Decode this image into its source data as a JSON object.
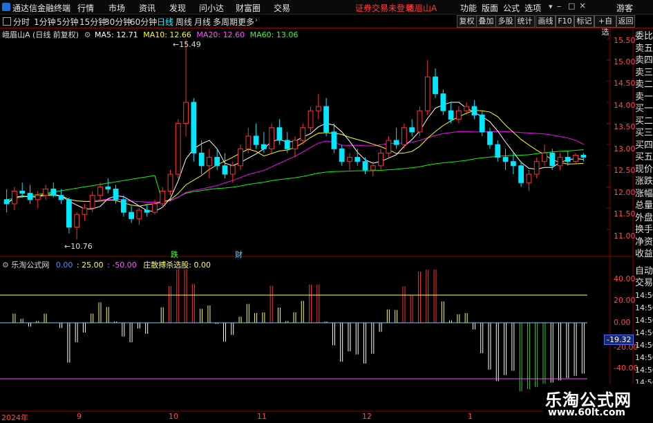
{
  "menu": {
    "app_title": "通达信金融终端",
    "items": [
      "行情",
      "市场",
      "资讯",
      "发现",
      "问小达",
      "财富圈",
      "交易"
    ],
    "status": "证券交易未登录",
    "stock": "峨眉山A",
    "right": [
      "功能",
      "版面",
      "公式",
      "选项"
    ],
    "guest": "游客"
  },
  "toolbar": {
    "periods": [
      "分时",
      "1分钟",
      "5分钟",
      "15分钟",
      "30分钟",
      "60分钟",
      "日线",
      "周线",
      "月线",
      "多周期",
      "更多"
    ],
    "active_period": "日线",
    "right_buttons": [
      "复权",
      "叠加",
      "多股",
      "统计",
      "画线",
      "F10",
      "标记",
      "+自选",
      "返回"
    ]
  },
  "legend": {
    "title": "峨眉山A (日线 前复权)",
    "ma5": "MA5: 12.71",
    "ma10": "MA10: 12.66",
    "ma20": "MA20: 12.60",
    "ma60": "MA60: 13.06",
    "colors": {
      "ma5": "#ffffff",
      "ma10": "#ffff00",
      "ma20": "#ff00ff",
      "ma60": "#00ff00"
    }
  },
  "indicator": {
    "name": "乐淘公式网",
    "v1": "0.00",
    "v2": ": 25.00",
    "v3": ": -50.00",
    "formula": "庄散搏杀选股: 0.00",
    "current": "-19.32"
  },
  "price_axis": [
    "15.50",
    "15.00",
    "14.50",
    "14.00",
    "13.50",
    "13.00",
    "12.50",
    "12.00",
    "11.50",
    "11.00"
  ],
  "ind_axis": [
    "40.00",
    "20.00",
    "0.00",
    "-20.00",
    "-40.00"
  ],
  "annotations": {
    "high": "15.49",
    "low": "10.76",
    "mark1": "跌",
    "mark2": "财"
  },
  "x_labels": [
    "2024年",
    "9",
    "10",
    "11",
    "12",
    "1"
  ],
  "side_panel": [
    "委比",
    "卖五",
    "卖四",
    "卖三",
    "卖二",
    "卖一",
    "买一",
    "买二",
    "买三",
    "买四",
    "买五",
    "现价",
    "涨跌",
    "涨幅",
    "总量",
    "外盘",
    "换手",
    "净资",
    "收益"
  ],
  "side_panel2": [
    "自动",
    "交易"
  ],
  "ind_side": [
    "14:56",
    "14:56",
    "14:56",
    "14:56",
    "14:56",
    "14:56",
    "14:56",
    "14:56",
    "14:56",
    "14:56"
  ],
  "watermark": {
    "line1": "乐淘公式网",
    "line2": "www.60lt.com"
  },
  "chart_data": {
    "type": "candlestick",
    "ylim": [
      10.7,
      15.6
    ],
    "ohlc": [
      [
        11.7,
        11.95,
        11.4,
        11.6
      ],
      [
        11.6,
        12.0,
        11.45,
        11.9
      ],
      [
        11.9,
        12.1,
        11.75,
        11.85
      ],
      [
        11.85,
        12.05,
        11.6,
        11.7
      ],
      [
        11.7,
        11.9,
        11.5,
        11.8
      ],
      [
        11.8,
        12.05,
        11.7,
        11.95
      ],
      [
        11.95,
        12.1,
        11.75,
        11.8
      ],
      [
        11.8,
        11.95,
        11.6,
        11.7
      ],
      [
        11.7,
        11.75,
        10.9,
        11.05
      ],
      [
        11.05,
        11.4,
        10.76,
        11.35
      ],
      [
        11.35,
        11.6,
        11.2,
        11.5
      ],
      [
        11.5,
        11.9,
        11.4,
        11.8
      ],
      [
        11.8,
        12.1,
        11.7,
        12.0
      ],
      [
        12.0,
        12.2,
        11.85,
        11.95
      ],
      [
        11.95,
        12.05,
        11.6,
        11.7
      ],
      [
        11.7,
        11.8,
        11.3,
        11.4
      ],
      [
        11.4,
        11.55,
        11.15,
        11.25
      ],
      [
        11.25,
        11.5,
        11.1,
        11.45
      ],
      [
        11.45,
        11.6,
        11.3,
        11.4
      ],
      [
        11.4,
        11.7,
        11.35,
        11.6
      ],
      [
        11.6,
        12.0,
        11.5,
        11.9
      ],
      [
        11.9,
        12.4,
        11.8,
        12.3
      ],
      [
        12.3,
        13.6,
        12.2,
        13.5
      ],
      [
        13.5,
        15.49,
        13.2,
        14.0
      ],
      [
        14.0,
        14.1,
        12.6,
        12.8
      ],
      [
        12.8,
        13.1,
        12.3,
        12.5
      ],
      [
        12.5,
        12.9,
        12.2,
        12.7
      ],
      [
        12.7,
        12.9,
        12.4,
        12.5
      ],
      [
        12.5,
        12.8,
        12.2,
        12.3
      ],
      [
        12.3,
        12.6,
        12.1,
        12.5
      ],
      [
        12.5,
        13.0,
        12.4,
        12.9
      ],
      [
        12.9,
        13.4,
        12.8,
        13.2
      ],
      [
        13.2,
        13.5,
        12.9,
        13.0
      ],
      [
        13.0,
        13.3,
        12.8,
        12.9
      ],
      [
        12.9,
        13.5,
        12.8,
        13.4
      ],
      [
        13.4,
        13.6,
        13.0,
        13.1
      ],
      [
        13.1,
        13.3,
        12.8,
        12.9
      ],
      [
        12.9,
        13.2,
        12.7,
        13.1
      ],
      [
        13.1,
        13.5,
        13.0,
        13.4
      ],
      [
        13.4,
        13.9,
        13.3,
        13.8
      ],
      [
        13.8,
        14.2,
        13.6,
        13.9
      ],
      [
        13.9,
        14.1,
        13.2,
        13.3
      ],
      [
        13.3,
        13.5,
        12.8,
        12.9
      ],
      [
        12.9,
        13.0,
        12.5,
        12.6
      ],
      [
        12.6,
        12.8,
        12.4,
        12.7
      ],
      [
        12.7,
        12.9,
        12.5,
        12.6
      ],
      [
        12.6,
        12.7,
        12.3,
        12.4
      ],
      [
        12.4,
        12.6,
        12.25,
        12.5
      ],
      [
        12.5,
        12.9,
        12.4,
        12.8
      ],
      [
        12.8,
        13.2,
        12.7,
        13.1
      ],
      [
        13.1,
        13.4,
        12.9,
        13.0
      ],
      [
        13.0,
        13.5,
        12.9,
        13.4
      ],
      [
        13.4,
        13.6,
        13.2,
        13.3
      ],
      [
        13.3,
        13.9,
        13.2,
        13.8
      ],
      [
        13.8,
        15.0,
        13.7,
        14.6
      ],
      [
        14.6,
        14.8,
        14.1,
        14.2
      ],
      [
        14.2,
        14.3,
        13.7,
        13.8
      ],
      [
        13.8,
        14.0,
        13.5,
        13.6
      ],
      [
        13.6,
        13.9,
        13.5,
        13.8
      ],
      [
        13.8,
        14.0,
        13.7,
        13.9
      ],
      [
        13.9,
        14.05,
        13.6,
        13.7
      ],
      [
        13.7,
        13.8,
        13.2,
        13.3
      ],
      [
        13.3,
        13.4,
        12.9,
        13.0
      ],
      [
        13.0,
        13.1,
        12.6,
        12.7
      ],
      [
        12.7,
        12.9,
        12.4,
        12.6
      ],
      [
        12.6,
        12.8,
        12.3,
        12.5
      ],
      [
        12.5,
        12.6,
        12.0,
        12.1
      ],
      [
        12.1,
        12.4,
        11.9,
        12.3
      ],
      [
        12.3,
        12.7,
        12.2,
        12.6
      ],
      [
        12.6,
        13.0,
        12.5,
        12.8
      ],
      [
        12.8,
        12.9,
        12.4,
        12.5
      ],
      [
        12.5,
        12.8,
        12.4,
        12.7
      ],
      [
        12.7,
        12.85,
        12.5,
        12.6
      ],
      [
        12.6,
        12.8,
        12.55,
        12.75
      ],
      [
        12.75,
        12.8,
        12.6,
        12.7
      ]
    ]
  }
}
